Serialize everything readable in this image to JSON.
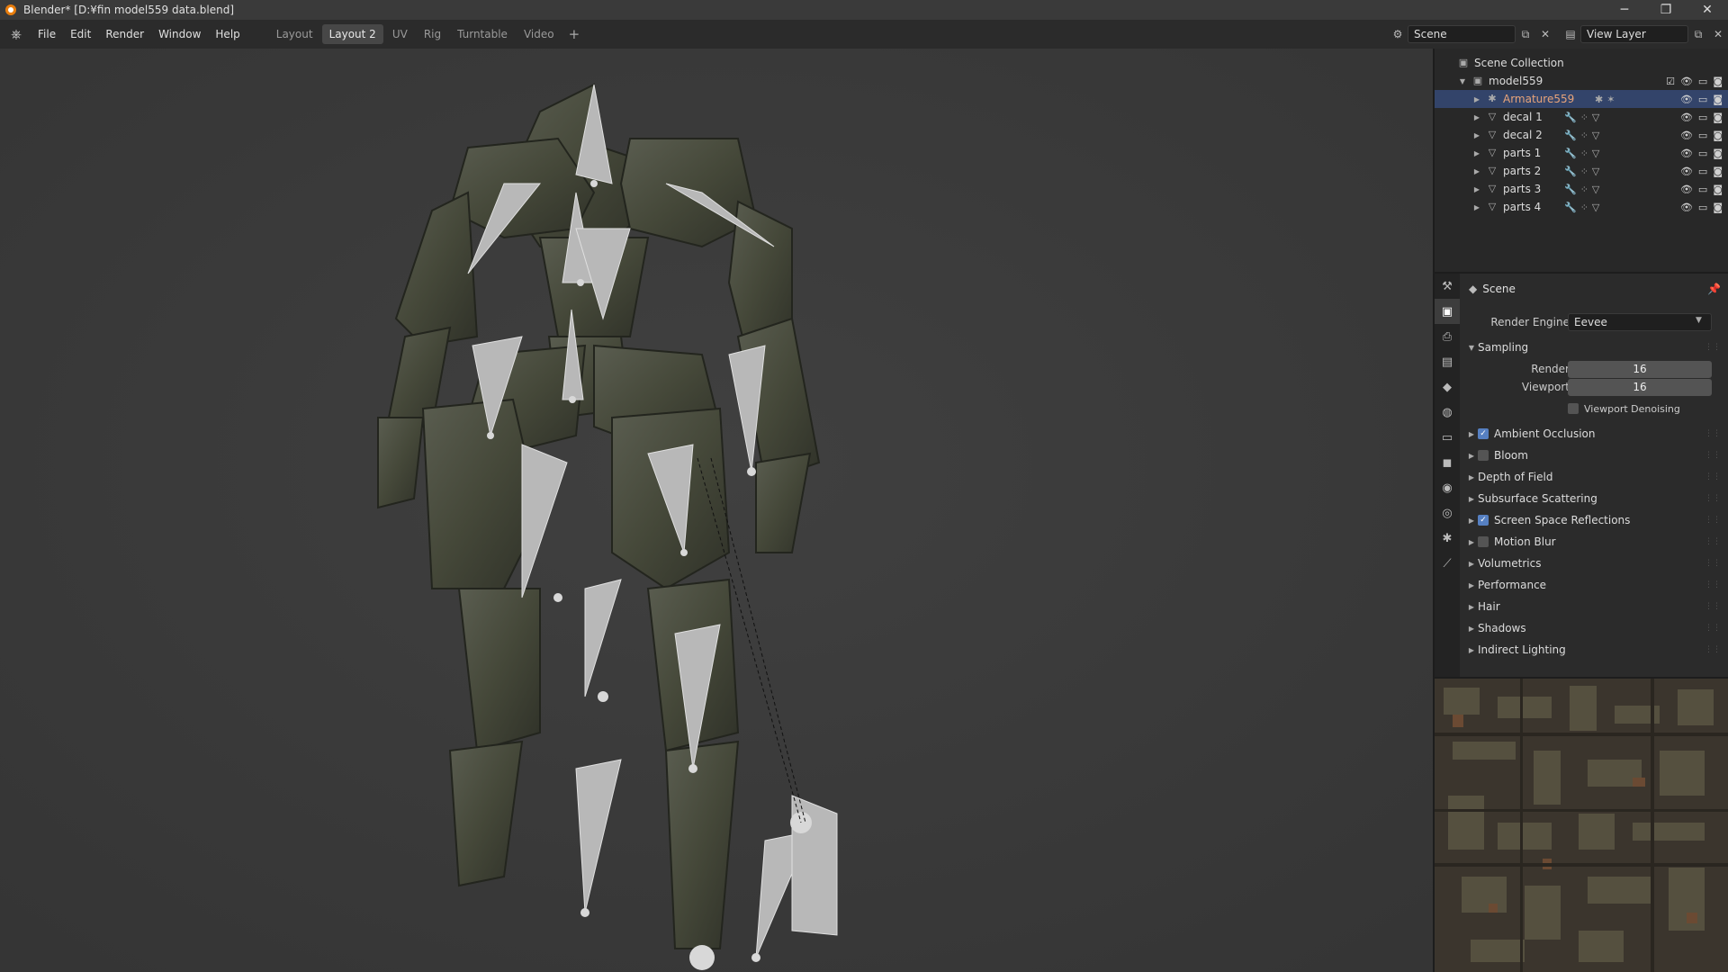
{
  "titlebar": {
    "title": "Blender* [D:¥fin model559 data.blend]",
    "minimize": "─",
    "maximize": "❐",
    "close": "✕"
  },
  "menubar": {
    "menus": [
      "File",
      "Edit",
      "Render",
      "Window",
      "Help"
    ],
    "workspaces": [
      "Layout",
      "Layout 2",
      "UV",
      "Rig",
      "Turntable",
      "Video"
    ],
    "active_workspace": "Layout 2",
    "add_workspace": "+",
    "scene_field": "Scene",
    "view_layer_field": "View Layer"
  },
  "outliner": {
    "root": "Scene Collection",
    "collection": "model559",
    "items": [
      {
        "label": "Armature559",
        "selected": true,
        "type": "armature"
      },
      {
        "label": "decal 1",
        "type": "mesh"
      },
      {
        "label": "decal 2",
        "type": "mesh"
      },
      {
        "label": "parts 1",
        "type": "mesh"
      },
      {
        "label": "parts 2",
        "type": "mesh"
      },
      {
        "label": "parts 3",
        "type": "mesh"
      },
      {
        "label": "parts 4",
        "type": "mesh"
      }
    ]
  },
  "properties": {
    "header": "Scene",
    "render_engine_label": "Render Engine",
    "render_engine_value": "Eevee",
    "sampling": {
      "title": "Sampling",
      "render_label": "Render",
      "render_value": "16",
      "viewport_label": "Viewport",
      "viewport_value": "16",
      "denoise_label": "Viewport Denoising"
    },
    "panels": [
      {
        "label": "Ambient Occlusion",
        "checkbox": true,
        "checked": true
      },
      {
        "label": "Bloom",
        "checkbox": true,
        "checked": false
      },
      {
        "label": "Depth of Field",
        "checkbox": false
      },
      {
        "label": "Subsurface Scattering",
        "checkbox": false
      },
      {
        "label": "Screen Space Reflections",
        "checkbox": true,
        "checked": true
      },
      {
        "label": "Motion Blur",
        "checkbox": true,
        "checked": false
      },
      {
        "label": "Volumetrics",
        "checkbox": false
      },
      {
        "label": "Performance",
        "checkbox": false
      },
      {
        "label": "Hair",
        "checkbox": false
      },
      {
        "label": "Shadows",
        "checkbox": false
      },
      {
        "label": "Indirect Lighting",
        "checkbox": false
      }
    ]
  },
  "colors": {
    "selection": "#33446a",
    "accent": "#e87d0d",
    "checkbox_on": "#5680c2"
  }
}
